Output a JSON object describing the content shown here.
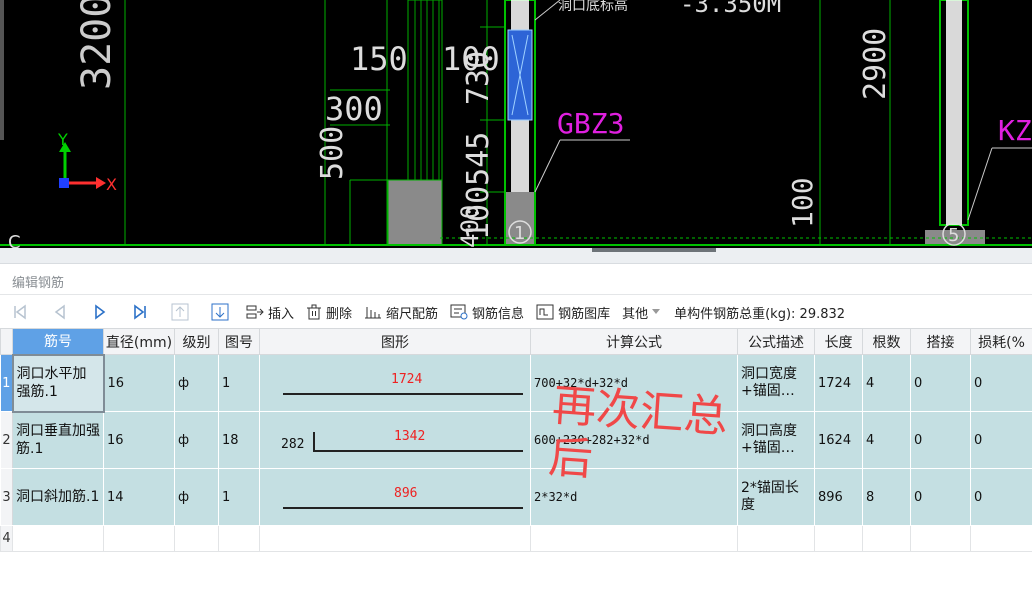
{
  "cad": {
    "dims": [
      "3200",
      "150",
      "100",
      "730",
      "300",
      "500",
      "100545",
      "2900",
      "100",
      "400"
    ],
    "labels": {
      "gbz": "GBZ3",
      "kz": "KZ",
      "top_text": "洞口底标高",
      "elev": "-3.350M",
      "axis_x": "X",
      "axis_y": "Y",
      "axis_c": "C"
    },
    "markers": [
      "1",
      "5"
    ]
  },
  "panel": {
    "title": "编辑钢筋"
  },
  "toolbar": {
    "insert": "插入",
    "delete": "删除",
    "scale": "缩尺配筋",
    "info": "钢筋信息",
    "library": "钢筋图库",
    "other": "其他",
    "total_label": "单构件钢筋总重(kg):",
    "total_value": "29.832"
  },
  "table": {
    "columns": [
      "筋号",
      "直径(mm)",
      "级别",
      "图号",
      "图形",
      "计算公式",
      "公式描述",
      "长度",
      "根数",
      "搭接",
      "损耗(%"
    ],
    "rows": [
      {
        "num": "1",
        "name": "洞口水平加强筋.1",
        "dia": "16",
        "grade": "ф",
        "fig": "1",
        "shape_val": "1724",
        "shape_lbl": "",
        "formula": "700+32*d+32*d",
        "desc": "洞口宽度+锚固…",
        "len": "1724",
        "count": "4",
        "lap": "0",
        "loss": "0"
      },
      {
        "num": "2",
        "name": "洞口垂直加强筋.1",
        "dia": "16",
        "grade": "ф",
        "fig": "18",
        "shape_val": "1342",
        "shape_lbl": "282",
        "formula": "600+230+282+32*d",
        "desc": "洞口高度+锚固…",
        "len": "1624",
        "count": "4",
        "lap": "0",
        "loss": "0"
      },
      {
        "num": "3",
        "name": "洞口斜加筋.1",
        "dia": "14",
        "grade": "ф",
        "fig": "1",
        "shape_val": "896",
        "shape_lbl": "",
        "formula": "2*32*d",
        "desc": "2*锚固长度",
        "len": "896",
        "count": "8",
        "lap": "0",
        "loss": "0"
      }
    ],
    "empty_row_num": "4"
  },
  "annotation": {
    "line1": "再次汇总",
    "line2": "后"
  },
  "colors": {
    "cad_green": "#00c000",
    "magenta": "#e020e0",
    "row_bg": "#c4dfe2",
    "header_sel": "#5fa1e6",
    "annot": "#f04848"
  }
}
